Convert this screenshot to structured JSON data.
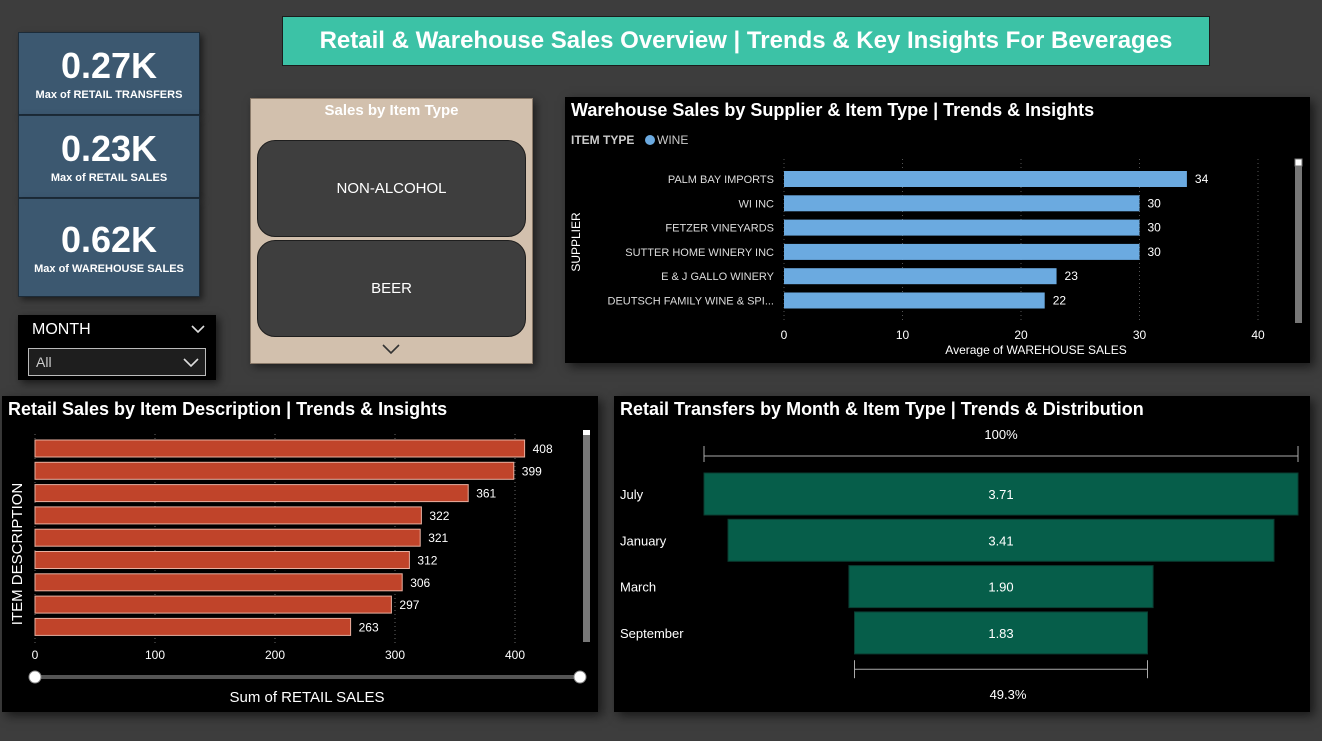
{
  "header": {
    "title": "Retail & Warehouse Sales Overview | Trends & Key Insights For Beverages"
  },
  "kpis": [
    {
      "value": "0.27K",
      "label": "Max of RETAIL TRANSFERS"
    },
    {
      "value": "0.23K",
      "label": "Max of RETAIL SALES"
    },
    {
      "value": "0.62K",
      "label": "Max of WAREHOUSE SALES"
    }
  ],
  "month_slicer": {
    "title": "MONTH",
    "selected": "All"
  },
  "item_type_slicer": {
    "title": "Sales by Item Type",
    "options": [
      "NON-ALCOHOL",
      "BEER"
    ]
  },
  "colors": {
    "title_bg": "#3cc2a6",
    "kpi_bg": "#3c5870",
    "warehouse_bar": "#6baae0",
    "retail_bar": "#c0442a",
    "funnel": "#065e4a"
  },
  "chart_data": [
    {
      "type": "bar",
      "title": "Warehouse Sales by Supplier & Item Type | Trends & Insights",
      "legend_title": "ITEM TYPE",
      "legend_entries": [
        "WINE"
      ],
      "categories": [
        "PALM BAY IMPORTS",
        "WI INC",
        "FETZER VINEYARDS",
        "SUTTER HOME WINERY INC",
        "E & J GALLO WINERY",
        "DEUTSCH FAMILY WINE & SPI..."
      ],
      "values": [
        34,
        30,
        30,
        30,
        23,
        22
      ],
      "ylabel": "SUPPLIER",
      "xlabel": "Average of WAREHOUSE SALES",
      "xticks": [
        0,
        10,
        20,
        30,
        40
      ],
      "xlim": [
        0,
        40
      ]
    },
    {
      "type": "bar",
      "title": "Retail Sales by Item Description | Trends & Insights",
      "values": [
        408,
        399,
        361,
        322,
        321,
        312,
        306,
        297,
        263
      ],
      "ylabel": "ITEM DESCRIPTION",
      "xlabel": "Sum of RETAIL SALES",
      "xticks": [
        0,
        100,
        200,
        300,
        400
      ],
      "xlim": [
        0,
        400
      ]
    },
    {
      "type": "bar",
      "title": "Retail Transfers by Month & Item Type | Trends & Distribution",
      "categories": [
        "July",
        "January",
        "March",
        "September"
      ],
      "values": [
        3.71,
        3.41,
        1.9,
        1.83
      ],
      "value_labels": [
        "3.71",
        "3.41",
        "1.90",
        "1.83"
      ],
      "top_percent": "100%",
      "bottom_percent": "49.3%"
    }
  ]
}
